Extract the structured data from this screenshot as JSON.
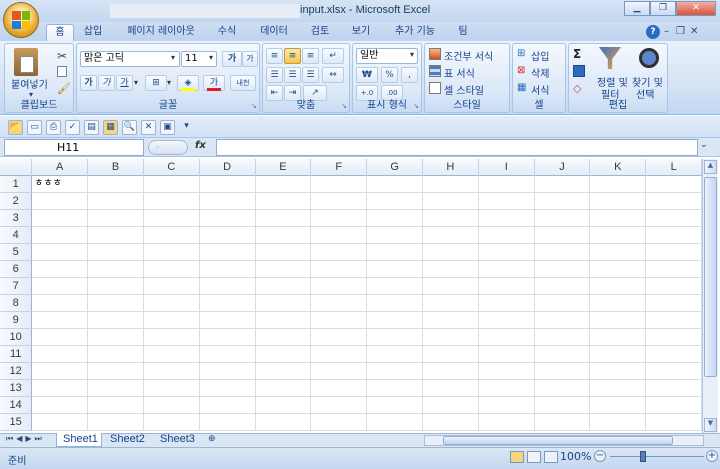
{
  "window": {
    "title": "input.xlsx - Microsoft Excel",
    "minimize": "▁",
    "restore": "❐",
    "close": "✕",
    "inner_minimize": "–",
    "inner_restore": "❐",
    "inner_close": "✕",
    "help": "?"
  },
  "ribbon_tabs": [
    {
      "label": "홈",
      "active": true
    },
    {
      "label": "삽입"
    },
    {
      "label": "페이지 레이아웃"
    },
    {
      "label": "수식"
    },
    {
      "label": "데이터"
    },
    {
      "label": "검토"
    },
    {
      "label": "보기"
    },
    {
      "label": "추가 기능"
    },
    {
      "label": "팀"
    }
  ],
  "groups": {
    "clipboard": {
      "label": "클립보드",
      "paste": "붙여넣기"
    },
    "font": {
      "label": "글꼴",
      "font_name": "맑은 고딕",
      "font_size": "11",
      "bold": "가",
      "italic": "가",
      "underline": "가",
      "grow": "가",
      "shrink": "가",
      "phonetic": "내천"
    },
    "alignment": {
      "label": "맞춤"
    },
    "number": {
      "label": "표시 형식",
      "format": "일반",
      "currency": "₩",
      "percent": "%",
      "comma": ","
    },
    "styles": {
      "label": "스타일",
      "conditional": "조건부 서식",
      "table": "표 서식",
      "cell_style": "셀 스타일"
    },
    "cells": {
      "label": "셀",
      "insert": "삽입",
      "delete": "삭제",
      "format": "서식"
    },
    "editing": {
      "label": "편집",
      "sort_filter": "정렬 및",
      "sort_filter2": "필터",
      "find_select": "찾기 및",
      "find_select2": "선택"
    }
  },
  "formula_bar": {
    "name_box": "H11",
    "fx": "fx",
    "formula": ""
  },
  "grid": {
    "columns": [
      "A",
      "B",
      "C",
      "D",
      "E",
      "F",
      "G",
      "H",
      "I",
      "J",
      "K",
      "L"
    ],
    "rows": [
      "1",
      "2",
      "3",
      "4",
      "5",
      "6",
      "7",
      "8",
      "9",
      "10",
      "11",
      "12",
      "13",
      "14",
      "15"
    ],
    "cells": {
      "A1": "ㅎㅎㅎ"
    }
  },
  "sheets": [
    "Sheet1",
    "Sheet2",
    "Sheet3"
  ],
  "status": {
    "ready": "준비",
    "zoom": "100%"
  }
}
